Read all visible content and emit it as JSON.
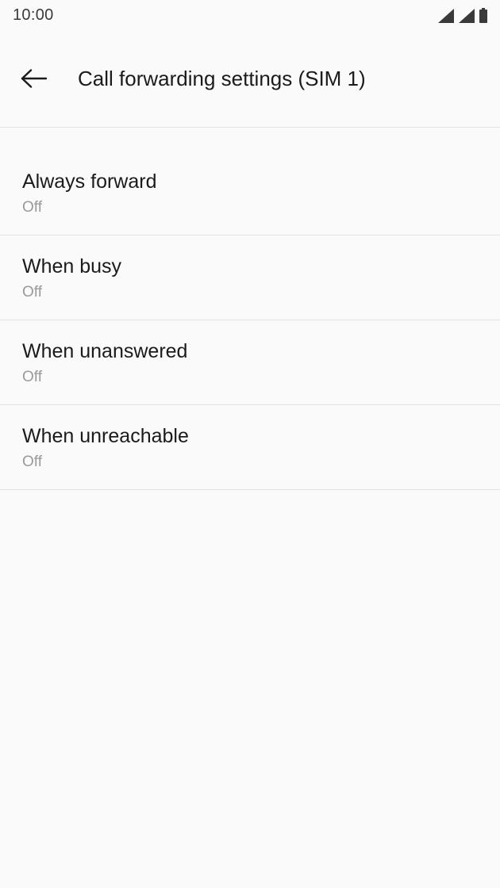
{
  "status_bar": {
    "time": "10:00",
    "icons": [
      "signal-icon",
      "signal-icon",
      "battery-icon"
    ]
  },
  "app_bar": {
    "back_icon": "arrow-left-icon",
    "title": "Call forwarding settings (SIM 1)"
  },
  "settings": {
    "items": [
      {
        "title": "Always forward",
        "summary": "Off"
      },
      {
        "title": "When busy",
        "summary": "Off"
      },
      {
        "title": "When unanswered",
        "summary": "Off"
      },
      {
        "title": "When unreachable",
        "summary": "Off"
      }
    ]
  },
  "colors": {
    "background": "#fafafa",
    "divider": "#e3e3e3",
    "primary_text": "#1b1b1b",
    "secondary_text": "#9a9a9a"
  }
}
